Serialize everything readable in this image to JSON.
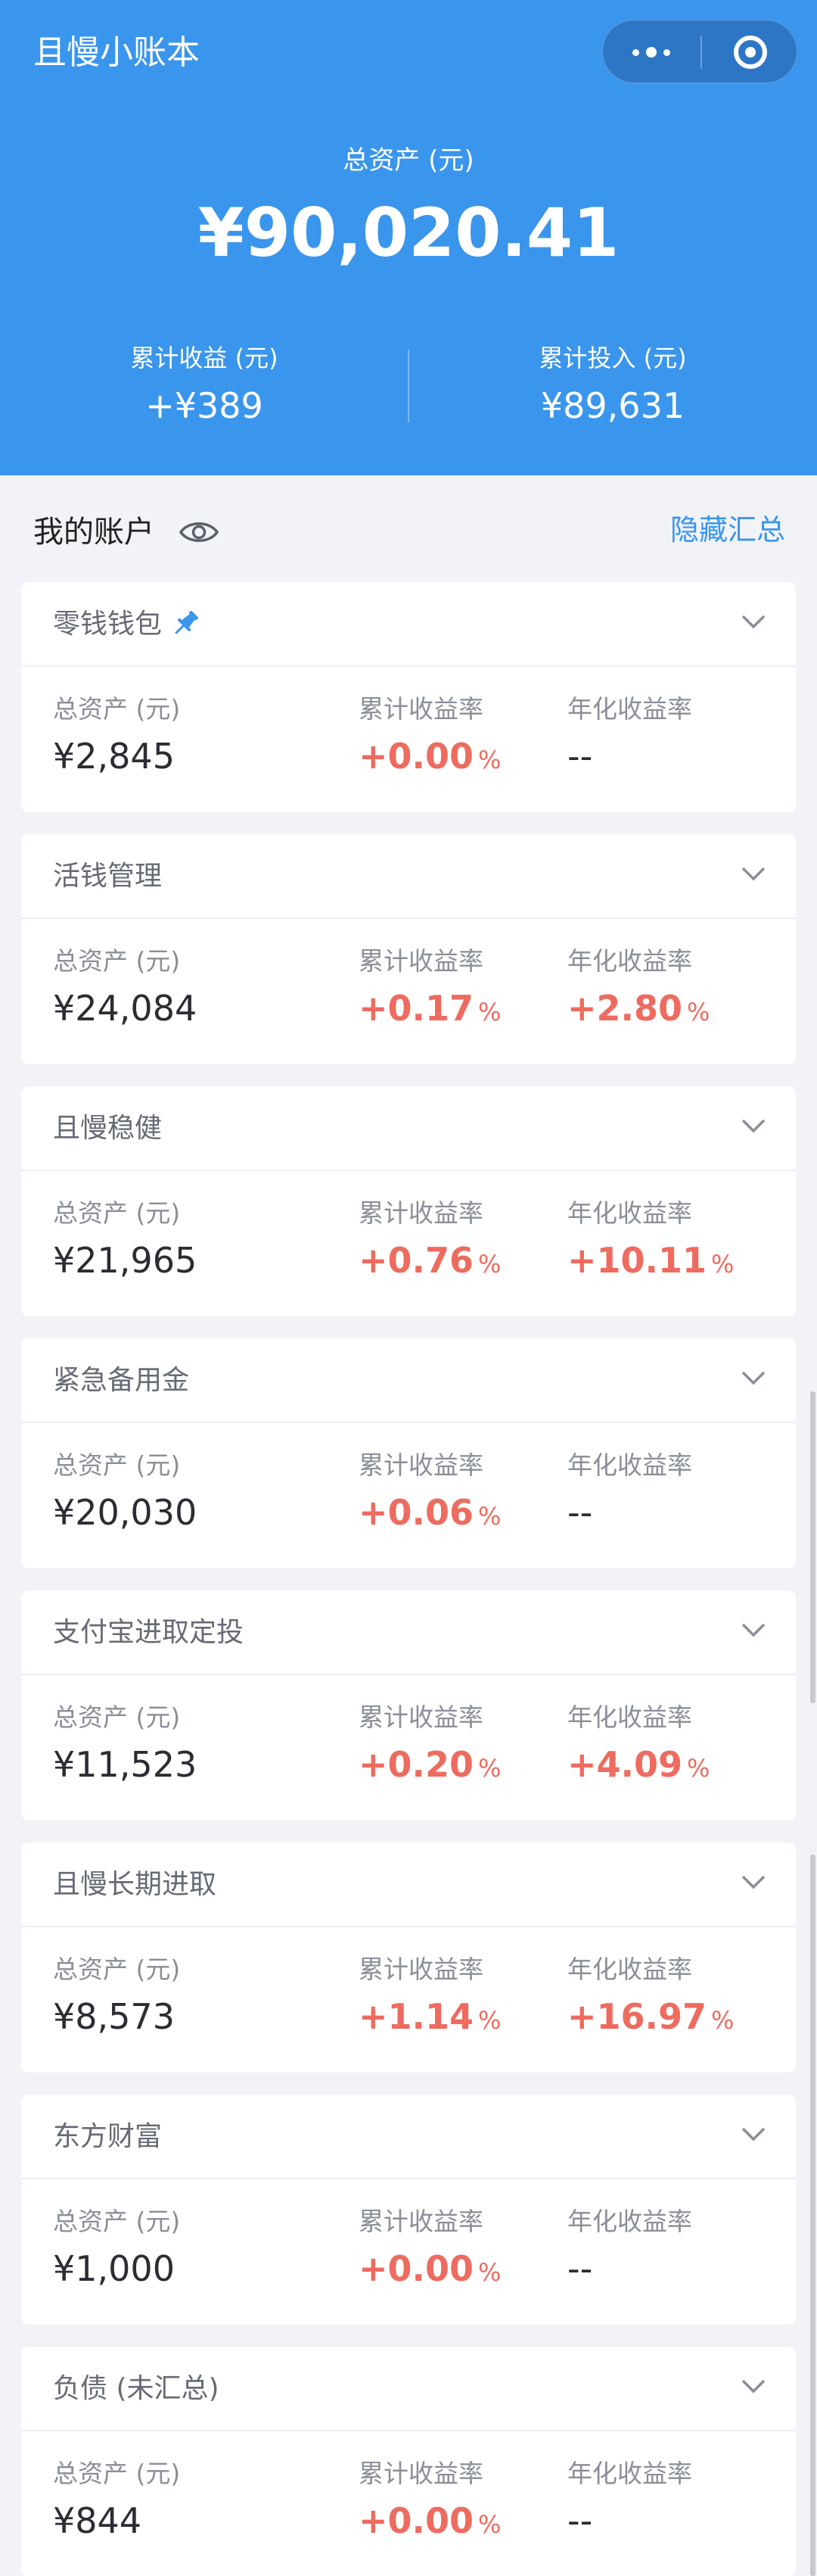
{
  "app": {
    "title": "且慢小账本"
  },
  "summary": {
    "total_label": "总资产 (元)",
    "total_value": "¥90,020.41",
    "cum_income_label": "累计收益 (元)",
    "cum_income_value": "+¥389",
    "cum_invest_label": "累计投入 (元)",
    "cum_invest_value": "¥89,631"
  },
  "accounts_section": {
    "title": "我的账户",
    "hide_summary_label": "隐藏汇总"
  },
  "labels": {
    "assets": "总资产 (元)",
    "cum_yield": "累计收益率",
    "annual_yield": "年化收益率"
  },
  "accounts": [
    {
      "name": "零钱钱包",
      "pinned": true,
      "assets": "¥2,845",
      "cum_yield": "+0.00",
      "annual_yield": "--"
    },
    {
      "name": "活钱管理",
      "assets": "¥24,084",
      "cum_yield": "+0.17",
      "annual_yield": "+2.80"
    },
    {
      "name": "且慢稳健",
      "assets": "¥21,965",
      "cum_yield": "+0.76",
      "annual_yield": "+10.11"
    },
    {
      "name": "紧急备用金",
      "assets": "¥20,030",
      "cum_yield": "+0.06",
      "annual_yield": "--"
    },
    {
      "name": "支付宝进取定投",
      "assets": "¥11,523",
      "cum_yield": "+0.20",
      "annual_yield": "+4.09"
    },
    {
      "name": "且慢长期进取",
      "assets": "¥8,573",
      "cum_yield": "+1.14",
      "annual_yield": "+16.97"
    },
    {
      "name": "东方财富",
      "assets": "¥1,000",
      "cum_yield": "+0.00",
      "annual_yield": "--"
    },
    {
      "name": "负债 (未汇总)",
      "assets": "¥844",
      "cum_yield": "+0.00",
      "annual_yield": "--"
    }
  ],
  "percent_symbol": "%",
  "colors": {
    "header_bg": "#3a95ec",
    "accent": "#3a95ec",
    "positive": "#ee6b5f",
    "page_bg": "#f2f3f7"
  },
  "icons": {
    "more": "more-dots-icon",
    "close": "close-miniprogram-icon",
    "eye": "eye-icon",
    "pin": "pin-icon",
    "chevron": "chevron-down-icon"
  }
}
